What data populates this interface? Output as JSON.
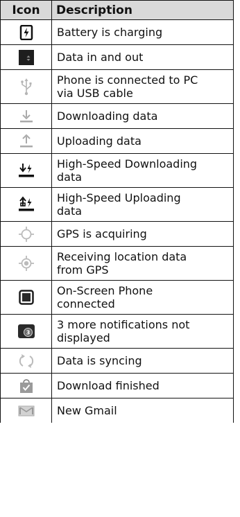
{
  "table": {
    "header_icon": "Icon",
    "header_description": "Description",
    "rows": [
      {
        "icon": "battery-charging-icon",
        "description": "Battery is charging"
      },
      {
        "icon": "data-in-out-icon",
        "description": "Data in and out"
      },
      {
        "icon": "usb-icon",
        "description": "Phone is connected to PC\nvia USB cable"
      },
      {
        "icon": "download-icon",
        "description": "Downloading data"
      },
      {
        "icon": "upload-icon",
        "description": "Uploading data"
      },
      {
        "icon": "high-speed-download-icon",
        "description": "High-Speed Downloading\ndata"
      },
      {
        "icon": "high-speed-upload-icon",
        "description": "High-Speed Uploading\ndata"
      },
      {
        "icon": "gps-acquiring-icon",
        "description": "GPS is acquiring"
      },
      {
        "icon": "gps-receiving-icon",
        "description": "Receiving location data\nfrom GPS"
      },
      {
        "icon": "on-screen-phone-icon",
        "description": "On-Screen Phone\nconnected"
      },
      {
        "icon": "more-notifications-icon",
        "description": "3 more notifications not\ndisplayed"
      },
      {
        "icon": "sync-icon",
        "description": "Data is syncing"
      },
      {
        "icon": "download-finished-icon",
        "description": "Download finished"
      },
      {
        "icon": "gmail-icon",
        "description": "New Gmail"
      }
    ]
  },
  "notification_count": "3"
}
